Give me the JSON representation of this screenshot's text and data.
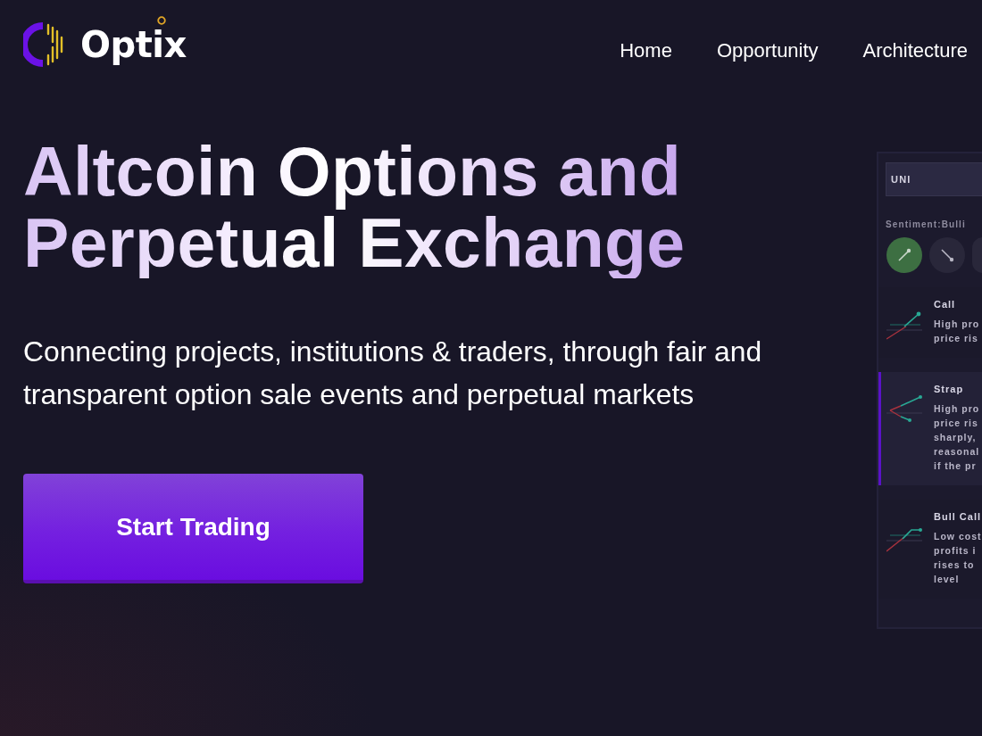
{
  "header": {
    "logo": {
      "text": "Optix"
    },
    "nav": [
      {
        "label": "Home"
      },
      {
        "label": "Opportunity"
      },
      {
        "label": "Architecture"
      }
    ]
  },
  "hero": {
    "title": "Altcoin Options and Perpetual Exchange",
    "subtitle": "Connecting projects, institutions & traders, through fair and transparent option sale events and perpetual markets",
    "cta": "Start Trading"
  },
  "app_preview": {
    "asset_field": {
      "value": "UNI"
    },
    "sentiment_label": "Sentiment:Bulli",
    "sentiment_buttons": [
      {
        "kind": "bullish",
        "selected": true
      },
      {
        "kind": "bearish",
        "selected": false
      },
      {
        "kind": "neutral",
        "selected": false
      }
    ],
    "strategies": [
      {
        "kind": "call",
        "name": "Call",
        "description_lines": [
          "High pro",
          "price ris"
        ],
        "selected": false
      },
      {
        "kind": "strap",
        "name": "Strap",
        "description_lines": [
          "High pro",
          "price ris",
          "sharply,",
          "reasonal",
          "if the pr"
        ],
        "selected": true
      },
      {
        "kind": "bull_call",
        "name": "Bull Call",
        "description_lines": [
          "Low cost",
          "profits i",
          "rises to",
          "level"
        ],
        "selected": false
      }
    ]
  }
}
